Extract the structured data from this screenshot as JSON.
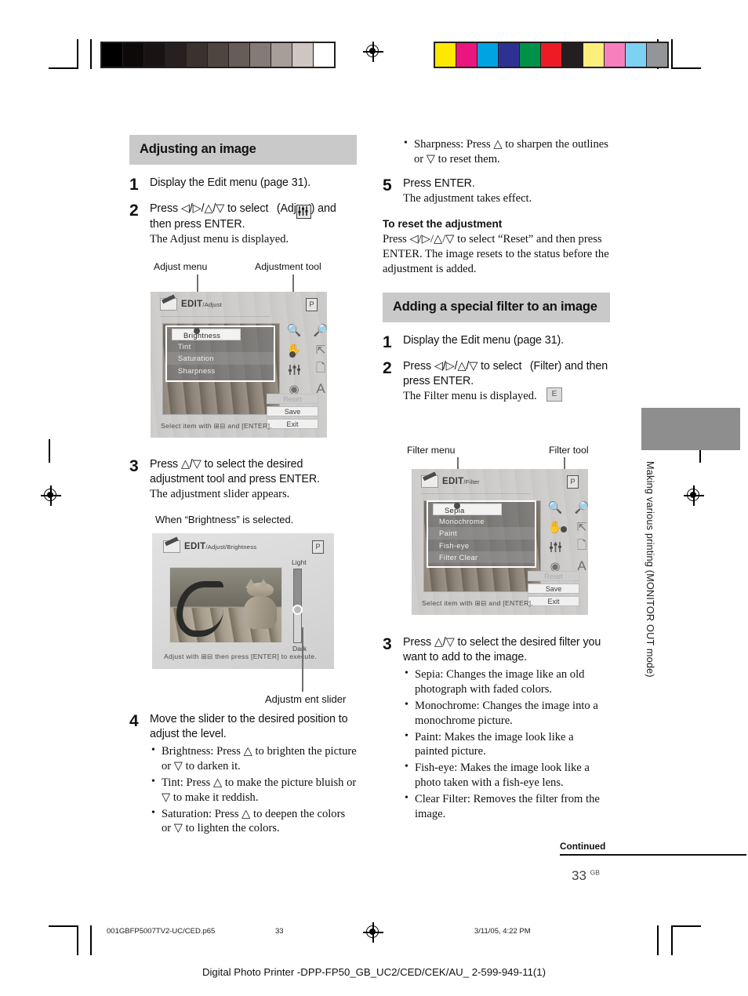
{
  "page": {
    "number": "33",
    "number_suffix": "GB",
    "continued_label": "Continued",
    "side_tab_text": "Making various printing  (MONITOR OUT mode)"
  },
  "color_bars": {
    "grayscale": [
      "#000000",
      "#0c0908",
      "#191413",
      "#262020",
      "#3a322e",
      "#4e4541",
      "#675d58",
      "#857b76",
      "#a79e99",
      "#cfc6c2",
      "#ffffff"
    ],
    "chromatic": [
      "#fde800",
      "#e9167f",
      "#00a3e2",
      "#2e3192",
      "#009248",
      "#ed1c24",
      "#231f20",
      "#fdef7c",
      "#f77fbd",
      "#7dd2f3",
      "#939598"
    ]
  },
  "left_column": {
    "section_title": "Adjusting an image",
    "steps": [
      {
        "num": "1",
        "lead": "Display the Edit menu (page 31).",
        "detail": ""
      },
      {
        "num": "2",
        "lead": "Press ◁/▷/△/▽ to select   (Adjust)  and then press ENTER.",
        "detail": "The Adjust menu is displayed."
      },
      {
        "num": "3",
        "lead": "Press △/▽ to select the desired adjustment tool and press ENTER.",
        "detail": "The adjustment slider appears."
      },
      {
        "num": "4",
        "lead": "Move the slider to the desired position to adjust the level.",
        "detail": "",
        "bullets": [
          "Brightness: Press △ to brighten the picture or ▽ to darken it.",
          "Tint: Press △ to make the picture bluish or ▽ to make it reddish.",
          "Saturation: Press △ to deepen the colors or ▽ to lighten the colors."
        ]
      }
    ],
    "fig1": {
      "label_left": "Adjust menu",
      "label_right": "Adjustment tool",
      "screen_title": "EDIT",
      "screen_path": "/Adjust",
      "menu_items": [
        "Brightness",
        "Tint",
        "Saturation",
        "Sharpness"
      ],
      "selected_item": "Brightness",
      "buttons": [
        "Reset",
        "Save",
        "Exit"
      ],
      "hint": "Select item with ⊞⊟ and [ENTER].",
      "corner_badge": "P"
    },
    "fig2": {
      "caption": "When “Brightness” is selected.",
      "screen_title": "EDIT",
      "screen_path": "/Adjust/Brightness",
      "slider_top_label": "Light",
      "slider_bottom_label": "Dark",
      "hint": "Adjust with ⊞⊟ then press [ENTER] to execute.",
      "corner_badge": "P",
      "label_below": "Adjustm ent slider"
    }
  },
  "right_column": {
    "top_bullet": "Sharpness:  Press △ to sharpen the outlines or ▽ to reset them.",
    "step5": {
      "num": "5",
      "lead": "Press ENTER.",
      "detail": "The adjustment takes effect."
    },
    "reset_heading": "To reset the adjustment",
    "reset_body": "Press ◁/▷/△/▽ to select “Reset” and then press ENTER. The image resets to the status before the adjustment is added.",
    "section_title": "Adding a special filter to an image",
    "steps": [
      {
        "num": "1",
        "lead": "Display the Edit menu (page 31).",
        "detail": ""
      },
      {
        "num": "2",
        "lead": "Press ◁/▷/△/▽ to select   (Filter) and then press ENTER.",
        "detail": "The Filter menu is displayed."
      },
      {
        "num": "3",
        "lead": "Press △/▽ to select the desired filter you want to add to the image.",
        "detail": "",
        "bullets": [
          "Sepia: Changes the image like an old photograph with faded colors.",
          "Monochrome: Changes the image into a monochrome picture.",
          "Paint: Makes the image look like a painted picture.",
          "Fish-eye: Makes the image look like a photo taken with a fish-eye lens.",
          "Clear Filter: Removes the filter from the image."
        ]
      }
    ],
    "fig3": {
      "label_left": "Filter menu",
      "label_right": "Filter tool",
      "screen_title": "EDIT",
      "screen_path": "/Filter",
      "menu_items": [
        "Sepia",
        "Monochrome",
        "Paint",
        "Fish-eye",
        "Filter  Clear"
      ],
      "selected_item": "Sepia",
      "buttons": [
        "Reset",
        "Save",
        "Exit"
      ],
      "hint": "Select item with ⊞⊟ and [ENTER].",
      "corner_badge": "P"
    }
  },
  "footer": {
    "filename": "001GBFP5007TV2-UC/CED.p65",
    "page": "33",
    "timestamp": "3/11/05, 4:22 PM",
    "title": "Digital Photo Printer -DPP-FP50_GB_UC2/CED/CEK/AU_ 2-599-949-11(1)"
  }
}
